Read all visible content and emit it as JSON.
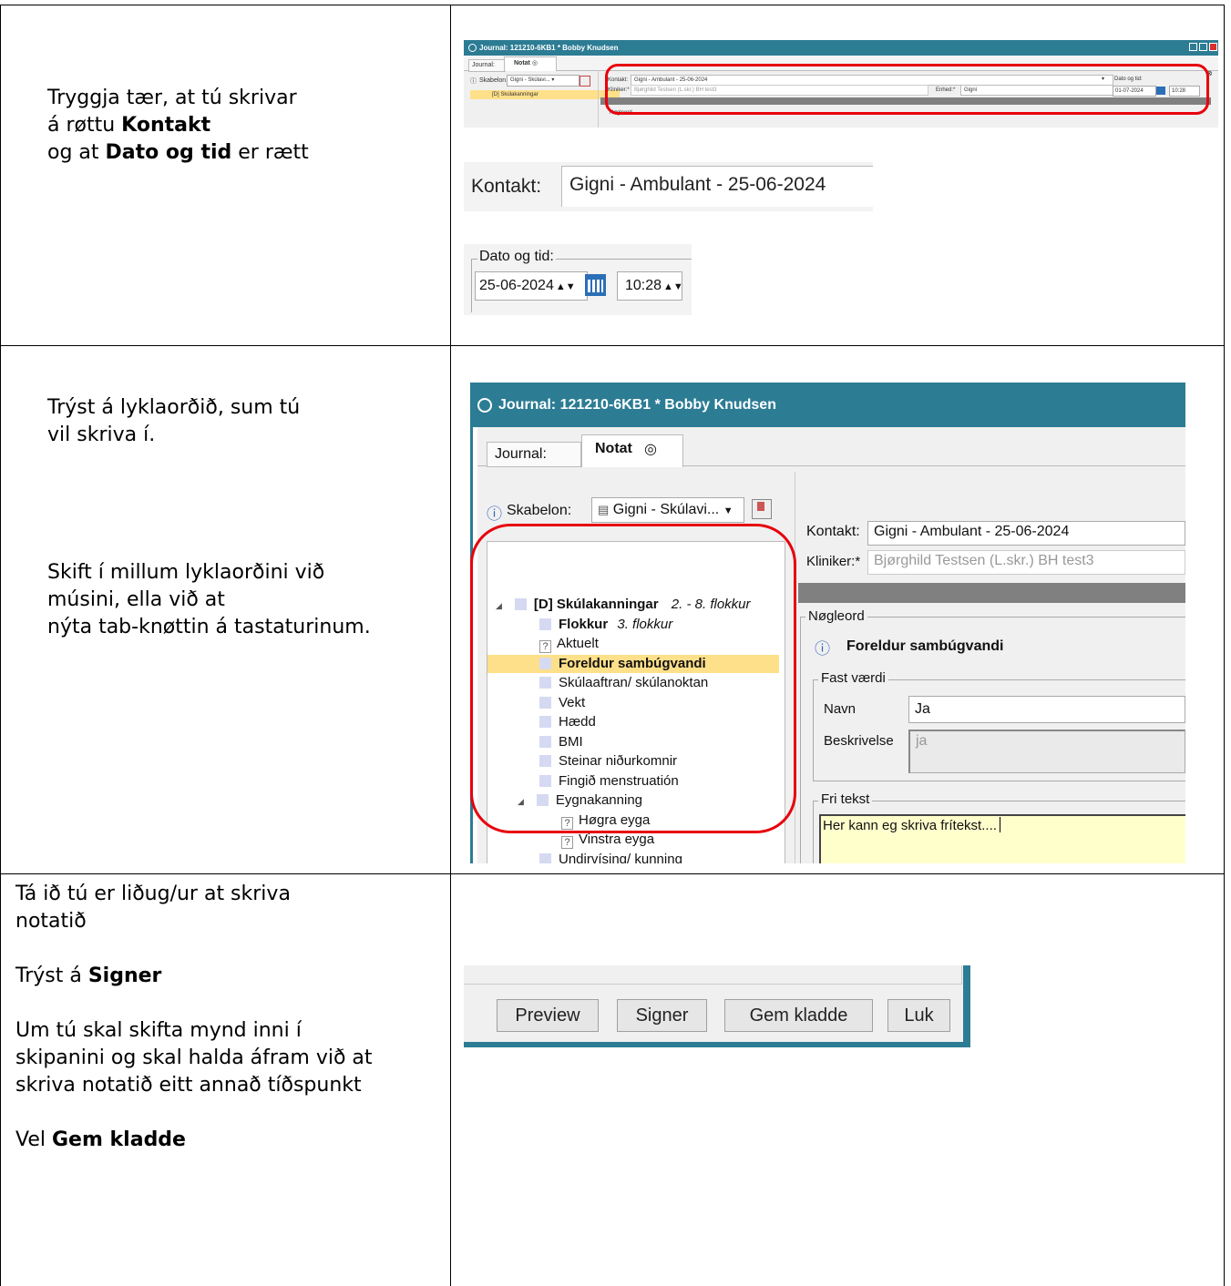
{
  "rows": [
    {
      "text_lines": [
        [
          {
            "t": "Tryggja tær, at tú skrivar",
            "b": false
          }
        ],
        [
          {
            "t": "á røttu ",
            "b": false
          },
          {
            "t": "Kontakt",
            "b": true
          }
        ],
        [
          {
            "t": "og at ",
            "b": false
          },
          {
            "t": "Dato og tid",
            "b": true
          },
          {
            "t": " er rætt",
            "b": false
          }
        ]
      ]
    },
    {
      "para1": [
        "Trýst á lyklaorðið, sum tú",
        "vil skriva í."
      ],
      "para2": [
        "Skift í millum lyklaorðini við",
        "músini, ella við at",
        "nýta tab-knøttin á tastaturinum."
      ]
    },
    {
      "lines": [
        [
          {
            "t": "Tá ið tú er liðug/ur at skriva",
            "b": false
          }
        ],
        [
          {
            "t": "notatið",
            "b": false
          }
        ],
        [],
        [
          {
            "t": "Trýst á ",
            "b": false
          },
          {
            "t": "Signer",
            "b": true
          }
        ],
        [],
        [
          {
            "t": "Um tú skal skifta mynd inni í",
            "b": false
          }
        ],
        [
          {
            "t": "skipanini og skal halda áfram við at",
            "b": false
          }
        ],
        [
          {
            "t": "skriva notatið eitt annað tíðspunkt",
            "b": false
          }
        ],
        [],
        [
          {
            "t": "Vel ",
            "b": false
          },
          {
            "t": "Gem kladde",
            "b": true
          }
        ]
      ]
    }
  ],
  "screenshot1": {
    "title": "Journal: 121210-6KB1 * Bobby Knudsen",
    "tab_journal": "Journal:",
    "tab_notat": "Notat",
    "skabelon_label": "Skabelon:",
    "skabelon_value": "Gigni - Skúlavi...",
    "tree_item": "[D] Skúlakanningar",
    "kontakt_label": "Kontakt:",
    "kontakt_value": "Gigni - Ambulant - 25-06-2024",
    "kliniker_label": "Kliniker:*",
    "kliniker_value": "Bjørghild Testsen (L.skr.) BH test3",
    "enhed_label": "Enhed:*",
    "enhed_value": "Gigni",
    "dato_label": "Dato og tid:",
    "dato_value": "01-07-2024",
    "tid_value": "10:28",
    "noegleord": "Nøgleord"
  },
  "kontakt_crop": {
    "label": "Kontakt:",
    "value": "Gigni - Ambulant -  25-06-2024"
  },
  "dato_crop": {
    "label": "Dato og tid:",
    "date": "25-06-2024",
    "time": "10:28"
  },
  "screenshot2": {
    "title": "Journal: 121210-6KB1 * Bobby Knudsen",
    "tab_journal": "Journal:",
    "tab_notat": "Notat",
    "skabelon_label": "Skabelon:",
    "skabelon_value": "Gigni - Skúlavi...",
    "kontakt_label": "Kontakt:",
    "kontakt_value": "Gigni - Ambulant -  25-06-2024",
    "kliniker_label": "Kliniker:*",
    "kliniker_value": "Bjørghild Testsen (L.skr.) BH test3",
    "tree": {
      "root": "[D] Skúlakanningar",
      "root_suffix": "2. - 8. flokkur",
      "flokkur": "Flokkur",
      "flokkur_suffix": "3. flokkur",
      "items": [
        "Aktuelt",
        "Foreldur sambúgvandi",
        "Skúlaaftran/ skúlanoktan",
        "Vekt",
        "Hædd",
        "BMI",
        "Steinar niðurkomnir",
        "Fingið menstruatión",
        "Eygnakanning",
        "Høgra eyga",
        "Vinstra eyga",
        "Undirvísing/ kunning"
      ]
    },
    "noegleord_label": "Nøgleord",
    "selected_keyword": "Foreldur sambúgvandi",
    "fast_vaerdi_label": "Fast værdi",
    "navn_label": "Navn",
    "navn_value": "Ja",
    "beskrivelse_label": "Beskrivelse",
    "beskrivelse_value": "ja",
    "fri_tekst_label": "Fri tekst",
    "fri_tekst_value": "Her kann eg skriva frítekst...."
  },
  "buttons": {
    "preview": "Preview",
    "signer": "Signer",
    "gem_kladde": "Gem kladde",
    "luk": "Luk"
  },
  "colors": {
    "titlebar": "#2c7c94",
    "highlight_ring": "#e8000b",
    "selected_row": "#ffe08a",
    "fri_tekst_bg": "#ffffcc"
  }
}
